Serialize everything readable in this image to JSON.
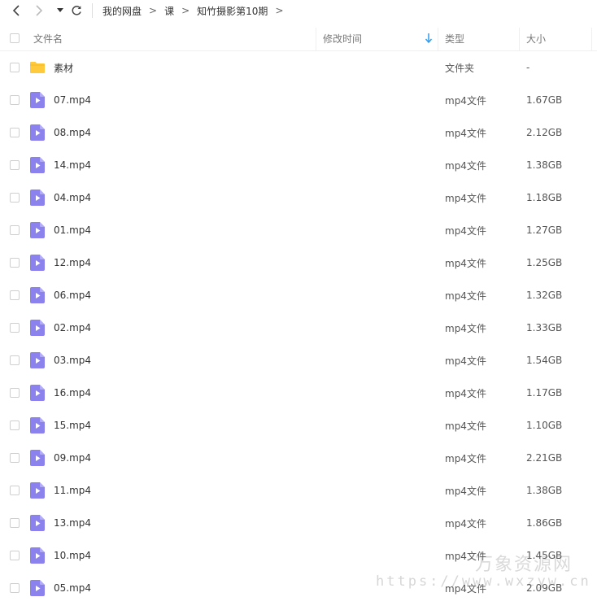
{
  "breadcrumb": [
    "我的网盘",
    "课",
    "知竹摄影第10期"
  ],
  "breadcrumb_separator": ">",
  "header": {
    "name": "文件名",
    "modified": "修改时间",
    "type": "类型",
    "size": "大小"
  },
  "files": [
    {
      "name": "素材",
      "type": "文件夹",
      "size": "-",
      "kind": "folder"
    },
    {
      "name": "07.mp4",
      "type": "mp4文件",
      "size": "1.67GB",
      "kind": "video"
    },
    {
      "name": "08.mp4",
      "type": "mp4文件",
      "size": "2.12GB",
      "kind": "video"
    },
    {
      "name": "14.mp4",
      "type": "mp4文件",
      "size": "1.38GB",
      "kind": "video"
    },
    {
      "name": "04.mp4",
      "type": "mp4文件",
      "size": "1.18GB",
      "kind": "video"
    },
    {
      "name": "01.mp4",
      "type": "mp4文件",
      "size": "1.27GB",
      "kind": "video"
    },
    {
      "name": "12.mp4",
      "type": "mp4文件",
      "size": "1.25GB",
      "kind": "video"
    },
    {
      "name": "06.mp4",
      "type": "mp4文件",
      "size": "1.32GB",
      "kind": "video"
    },
    {
      "name": "02.mp4",
      "type": "mp4文件",
      "size": "1.33GB",
      "kind": "video"
    },
    {
      "name": "03.mp4",
      "type": "mp4文件",
      "size": "1.54GB",
      "kind": "video"
    },
    {
      "name": "16.mp4",
      "type": "mp4文件",
      "size": "1.17GB",
      "kind": "video"
    },
    {
      "name": "15.mp4",
      "type": "mp4文件",
      "size": "1.10GB",
      "kind": "video"
    },
    {
      "name": "09.mp4",
      "type": "mp4文件",
      "size": "2.21GB",
      "kind": "video"
    },
    {
      "name": "11.mp4",
      "type": "mp4文件",
      "size": "1.38GB",
      "kind": "video"
    },
    {
      "name": "13.mp4",
      "type": "mp4文件",
      "size": "1.86GB",
      "kind": "video"
    },
    {
      "name": "10.mp4",
      "type": "mp4文件",
      "size": "1.45GB",
      "kind": "video"
    },
    {
      "name": "05.mp4",
      "type": "mp4文件",
      "size": "2.09GB",
      "kind": "video"
    }
  ],
  "watermark": {
    "title": "万象资源网",
    "url": "https://www.wxzyw.cn"
  },
  "colors": {
    "folder": "#FFCB3D",
    "video_icon": "#8C82EE",
    "sort_arrow": "#2F9BF0"
  },
  "icons": {
    "back": "chevron-left-icon",
    "forward": "chevron-right-icon",
    "history": "caret-down-icon",
    "refresh": "refresh-icon",
    "folder": "folder-icon",
    "video": "video-file-icon",
    "sort": "sort-descending-icon"
  }
}
